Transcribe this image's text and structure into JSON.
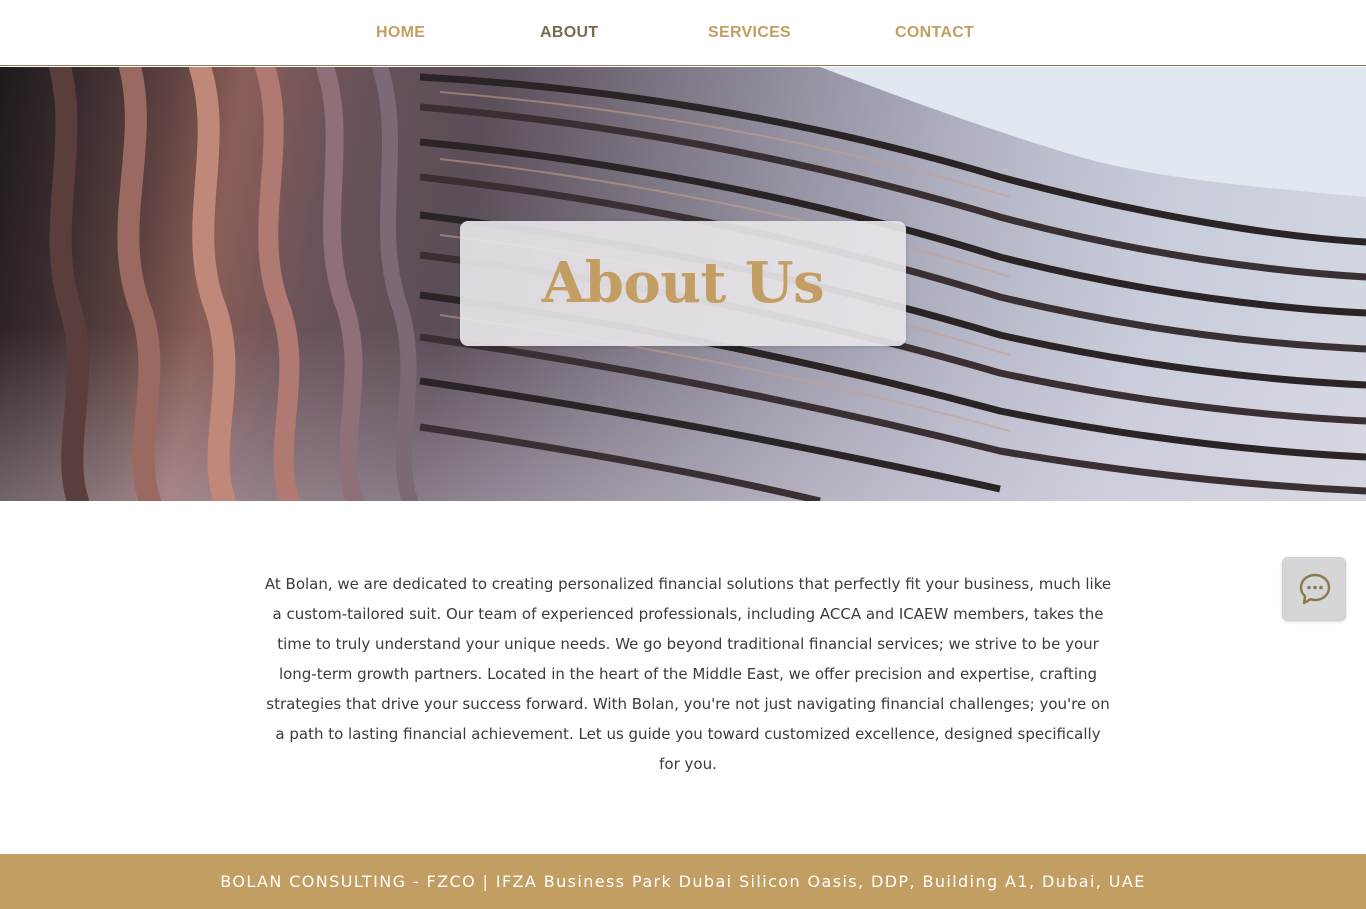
{
  "nav": {
    "items": [
      {
        "label": "HOME"
      },
      {
        "label": "ABOUT"
      },
      {
        "label": "SERVICES"
      },
      {
        "label": "CONTACT"
      }
    ],
    "active": "ABOUT"
  },
  "hero": {
    "title": "About Us"
  },
  "about": {
    "body": "At Bolan, we are dedicated to creating personalized financial solutions that perfectly fit your business, much like a custom-tailored suit. Our team of experienced professionals, including ACCA and ICAEW members, takes the time to truly understand your unique needs. We go beyond traditional financial services; we strive to be your long-term growth partners. Located in the heart of the Middle East, we offer precision and expertise, crafting strategies that drive your success forward. With Bolan, you're not just navigating financial challenges; you're on a path to lasting financial achievement. Let us guide you toward customized excellence, designed specifically for you."
  },
  "chat": {
    "icon": "chat-bubble-icon"
  },
  "footer": {
    "text": "BOLAN CONSULTING - FZCO | IFZA Business Park Dubai Silicon Oasis, DDP, Building A1, Dubai, UAE"
  },
  "colors": {
    "accent": "#c39e63",
    "nav_active": "#7a6a4c",
    "text": "#3b3b3b"
  }
}
